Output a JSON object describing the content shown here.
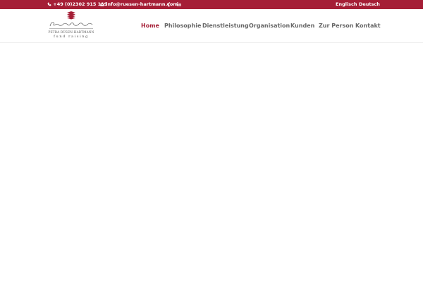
{
  "topbar": {
    "phone": "+49 (0)2302 915 119",
    "email": "info@ruesen-hartmann.com",
    "languages": [
      "Englisch",
      "Deutsch"
    ]
  },
  "logo": {
    "name": "PETRA RÜSEN-HARTMANN",
    "tagline": "fund raising"
  },
  "nav": {
    "items": [
      {
        "label": "Home",
        "active": true
      },
      {
        "label": "Philosophie"
      },
      {
        "label": "Dienstleistung"
      },
      {
        "label": "Organisation"
      },
      {
        "label": "Kunden"
      },
      {
        "label": "Zur Person"
      },
      {
        "label": "Kontakt"
      }
    ]
  },
  "colors": {
    "brand": "#a51e36",
    "nav_text": "#666666",
    "background": "#ffffff"
  },
  "icons": {
    "phone": "phone-icon",
    "email": "envelope-icon",
    "xing": "xing-icon",
    "linkedin": "linkedin-icon"
  }
}
